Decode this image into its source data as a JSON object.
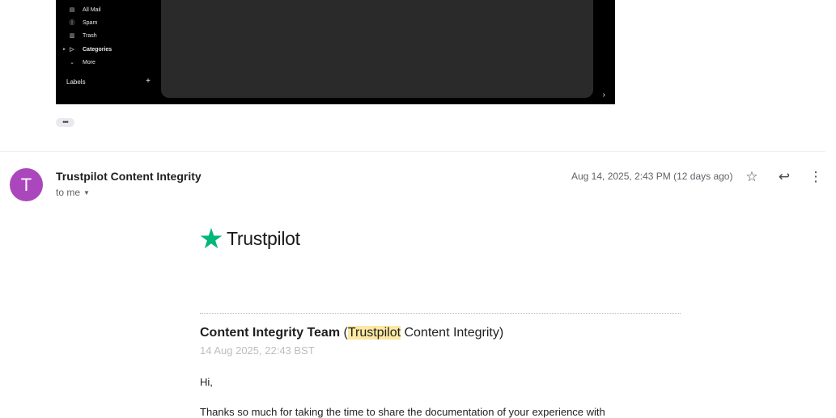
{
  "screenshot": {
    "nav_items": [
      {
        "label": "All Mail",
        "icon": "mail-stack-icon",
        "glyph": "▤"
      },
      {
        "label": "Spam",
        "icon": "spam-icon",
        "glyph": "⓪"
      },
      {
        "label": "Trash",
        "icon": "trash-icon",
        "glyph": "▥"
      },
      {
        "label": "Categories",
        "icon": "label-icon",
        "glyph": "▷",
        "expander": "▸"
      },
      {
        "label": "More",
        "icon": "chevron-down-icon",
        "glyph": "⌄"
      }
    ],
    "labels_heading": "Labels",
    "labels_add": "+",
    "pane_chevron": "›"
  },
  "expand_dots": "•••",
  "message": {
    "avatar_letter": "T",
    "avatar_color": "#ab47bc",
    "sender": "Trustpilot Content Integrity",
    "to": "to me",
    "date": "Aug 14, 2025, 2:43 PM (12 days ago)",
    "star_glyph": "☆",
    "reply_glyph": "↩",
    "more_glyph": "⋮"
  },
  "body": {
    "logo_text": "Trustpilot",
    "logo_color": "#00b67a",
    "team_bold": "Content Integrity Team",
    "team_open": " (",
    "team_highlight": "Trustpilot",
    "team_rest": " Content Integrity)",
    "sent_date": "14 Aug 2025, 22:43 BST",
    "greeting": "Hi,",
    "paragraph": "Thanks so much for taking the time to share the documentation of your experience with"
  }
}
